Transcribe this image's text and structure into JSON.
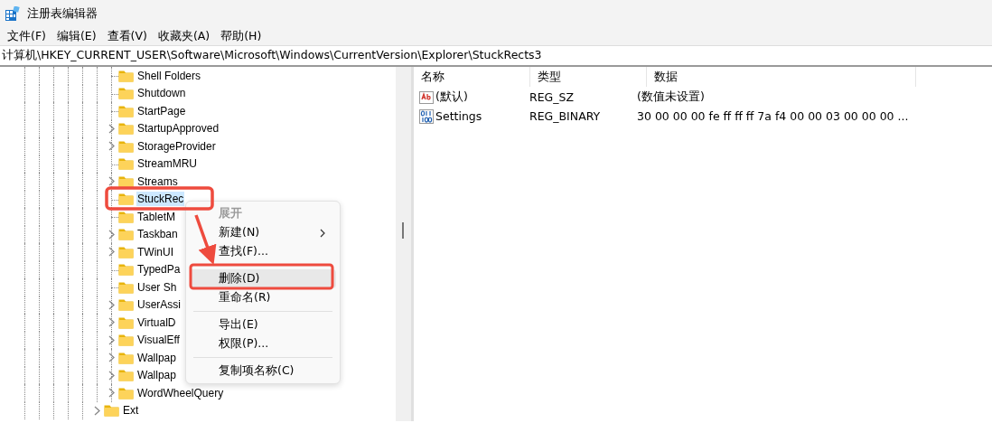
{
  "window": {
    "title": "注册表编辑器"
  },
  "menu_bar": [
    "文件(F)",
    "编辑(E)",
    "查看(V)",
    "收藏夹(A)",
    "帮助(H)"
  ],
  "address": "计算机\\HKEY_CURRENT_USER\\Software\\Microsoft\\Windows\\CurrentVersion\\Explorer\\StuckRects3",
  "tree": {
    "nodes": [
      {
        "label": "Shell Folders",
        "expandable": false,
        "selected": false
      },
      {
        "label": "Shutdown",
        "expandable": false,
        "selected": false
      },
      {
        "label": "StartPage",
        "expandable": false,
        "selected": false
      },
      {
        "label": "StartupApproved",
        "expandable": true,
        "selected": false
      },
      {
        "label": "StorageProvider",
        "expandable": true,
        "selected": false
      },
      {
        "label": "StreamMRU",
        "expandable": false,
        "selected": false
      },
      {
        "label": "Streams",
        "expandable": true,
        "selected": false
      },
      {
        "label": "StuckRec",
        "expandable": false,
        "selected": true
      },
      {
        "label": "TabletM",
        "expandable": false,
        "selected": false
      },
      {
        "label": "Taskban",
        "expandable": true,
        "selected": false
      },
      {
        "label": "TWinUI",
        "expandable": true,
        "selected": false
      },
      {
        "label": "TypedPa",
        "expandable": false,
        "selected": false
      },
      {
        "label": "User Sh",
        "expandable": false,
        "selected": false
      },
      {
        "label": "UserAssi",
        "expandable": true,
        "selected": false
      },
      {
        "label": "VirtualD",
        "expandable": true,
        "selected": false
      },
      {
        "label": "VisualEff",
        "expandable": true,
        "selected": false
      },
      {
        "label": "Wallpap",
        "expandable": true,
        "selected": false
      },
      {
        "label": "Wallpap",
        "expandable": true,
        "selected": false
      },
      {
        "label": "WordWheelQuery",
        "expandable": true,
        "selected": false
      }
    ],
    "outer_nodes": [
      {
        "label": "Ext",
        "expandable": true,
        "selected": false
      }
    ]
  },
  "values": {
    "columns": [
      "名称",
      "类型",
      "数据"
    ],
    "rows": [
      {
        "kind": "string",
        "name": "(默认)",
        "type": "REG_SZ",
        "data": "(数值未设置)"
      },
      {
        "kind": "binary",
        "name": "Settings",
        "type": "REG_BINARY",
        "data": "30 00 00 00 fe ff ff ff 7a f4 00 00 03 00 00 00 ..."
      }
    ]
  },
  "context_menu": [
    {
      "kind": "item",
      "label": "展开",
      "default": true,
      "disabled": true,
      "submenu": false,
      "selected": false
    },
    {
      "kind": "item",
      "label": "新建(N)",
      "default": false,
      "disabled": false,
      "submenu": true,
      "selected": false
    },
    {
      "kind": "item",
      "label": "查找(F)...",
      "default": false,
      "disabled": false,
      "submenu": false,
      "selected": false
    },
    {
      "kind": "separator"
    },
    {
      "kind": "item",
      "label": "删除(D)",
      "default": false,
      "disabled": false,
      "submenu": false,
      "selected": true
    },
    {
      "kind": "item",
      "label": "重命名(R)",
      "default": false,
      "disabled": false,
      "submenu": false,
      "selected": false
    },
    {
      "kind": "separator"
    },
    {
      "kind": "item",
      "label": "导出(E)",
      "default": false,
      "disabled": false,
      "submenu": false,
      "selected": false
    },
    {
      "kind": "item",
      "label": "权限(P)...",
      "default": false,
      "disabled": false,
      "submenu": false,
      "selected": false
    },
    {
      "kind": "separator"
    },
    {
      "kind": "item",
      "label": "复制项名称(C)",
      "default": false,
      "disabled": false,
      "submenu": false,
      "selected": false
    }
  ]
}
